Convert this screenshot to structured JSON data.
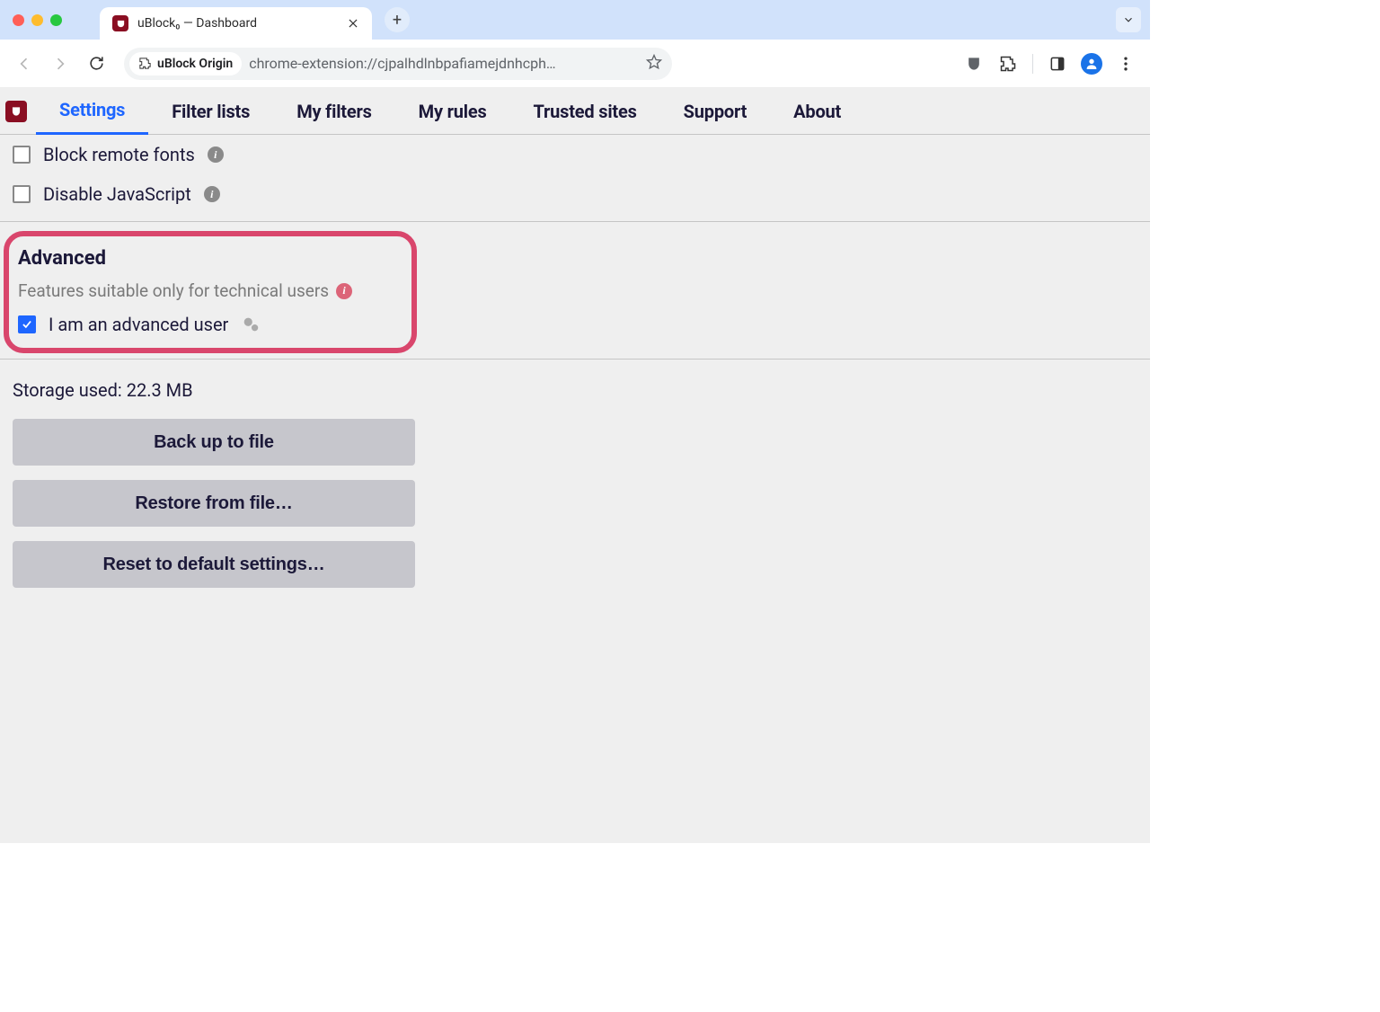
{
  "browser": {
    "tab_title": "uBlock₀ — Dashboard",
    "omnibox_chip": "uBlock Origin",
    "omnibox_url": "chrome-extension://cjpalhdlnbpafiamejdnhcph…"
  },
  "app_tabs": {
    "settings": "Settings",
    "filter_lists": "Filter lists",
    "my_filters": "My filters",
    "my_rules": "My rules",
    "trusted_sites": "Trusted sites",
    "support": "Support",
    "about": "About"
  },
  "settings": {
    "block_remote_fonts": "Block remote fonts",
    "disable_javascript": "Disable JavaScript"
  },
  "advanced": {
    "heading": "Advanced",
    "subtitle": "Features suitable only for technical users",
    "advanced_user": "I am an advanced user"
  },
  "storage_label": "Storage used: 22.3 MB",
  "buttons": {
    "backup": "Back up to file",
    "restore": "Restore from file…",
    "reset": "Reset to default settings…"
  }
}
